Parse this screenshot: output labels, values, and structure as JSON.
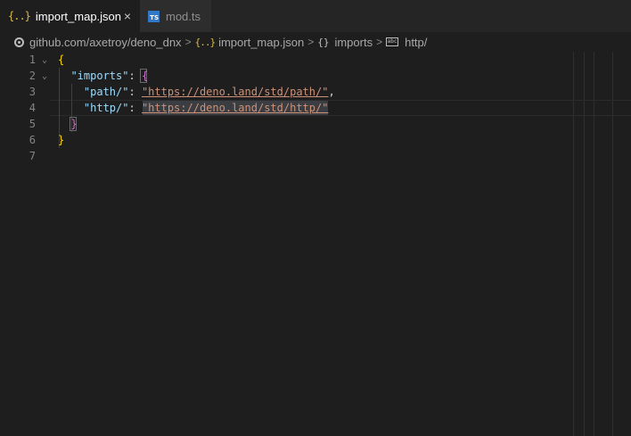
{
  "tabs": [
    {
      "icon": "{..}",
      "label": "import_map.json",
      "close": "×",
      "active": true
    },
    {
      "icon": "TS",
      "label": "mod.ts",
      "active": false
    }
  ],
  "breadcrumb": {
    "repo": "github.com/axetroy/deno_dnx",
    "file_icon": "{..}",
    "file": "import_map.json",
    "obj_icon": "{}",
    "key": "imports",
    "str_icon": "abc",
    "leaf": "http/",
    "separator": ">"
  },
  "editor": {
    "line_numbers": [
      "1",
      "2",
      "3",
      "4",
      "5",
      "6",
      "7"
    ],
    "lines": {
      "l1": {
        "open": "{"
      },
      "l2": {
        "key": "\"imports\"",
        "colon": ": ",
        "open": "{"
      },
      "l3": {
        "key": "\"path/\"",
        "colon": ": ",
        "value": "\"https://deno.land/std/path/\"",
        "comma": ","
      },
      "l4": {
        "key": "\"http/\"",
        "colon": ": ",
        "value": "\"https://deno.land/std/http/\""
      },
      "l5": {
        "close": "}"
      },
      "l6": {
        "close": "}"
      }
    },
    "fold_icon": "⌄"
  },
  "colors": {
    "background": "#1e1e1e",
    "key": "#9cdcfe",
    "string": "#ce9178",
    "bracket_outer": "#ffd700",
    "bracket_inner": "#da70d6"
  }
}
